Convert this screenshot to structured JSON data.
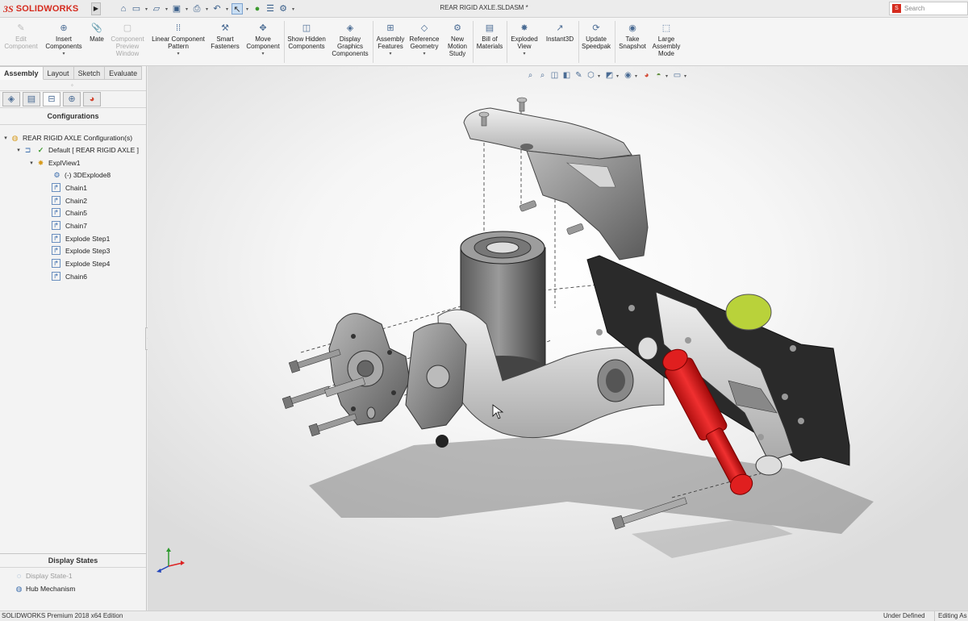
{
  "app": {
    "logo_mark": "3S",
    "logo_text": "SOLIDWORKS",
    "document_title": "REAR RIGID AXLE.SLDASM *",
    "search_placeholder": "Search MySolidWorks"
  },
  "quick_access": {
    "icons": [
      "home-icon",
      "new-document-icon",
      "open-icon",
      "save-icon",
      "print-icon",
      "undo-icon",
      "select-icon",
      "traffic-light-icon",
      "file-properties-icon",
      "options-icon"
    ]
  },
  "ribbon": {
    "edit_component": "Edit Component",
    "insert_components": "Insert Components",
    "mate": "Mate",
    "component_preview": "Component Preview Window",
    "linear_pattern": "Linear Component Pattern",
    "smart_fasteners": "Smart Fasteners",
    "move_component": "Move Component",
    "show_hidden": "Show Hidden Components",
    "display_graphics": "Display Graphics Components",
    "assembly_features": "Assembly Features",
    "reference_geometry": "Reference Geometry",
    "new_motion_study": "New Motion Study",
    "bill_of_materials": "Bill of Materials",
    "exploded_view": "Exploded View",
    "instant3d": "Instant3D",
    "update_speedpak": "Update Speedpak",
    "take_snapshot": "Take Snapshot",
    "large_assembly_mode": "Large Assembly Mode"
  },
  "tabs": [
    "Assembly",
    "Layout",
    "Sketch",
    "Evaluate"
  ],
  "config_manager": {
    "title": "Configurations",
    "tree": [
      "REAR RIGID AXLE Configuration(s)",
      "Default [ REAR RIGID AXLE ]",
      "ExplView1",
      "(-) 3DExplode8",
      "Chain1",
      "Chain2",
      "Chain5",
      "Chain7",
      "Explode Step1",
      "Explode Step3",
      "Explode Step4",
      "Chain6"
    ]
  },
  "display_states": {
    "title": "Display States",
    "items": [
      "Display State-1",
      "Hub Mechanism"
    ]
  },
  "status": {
    "edition": "SOLIDWORKS Premium 2018 x64 Edition",
    "state": "Under Defined",
    "mode": "Editing As"
  },
  "colors": {
    "brand_red": "#d52b1e",
    "shock_red": "#e01f1f",
    "accent_green": "#b9d23a",
    "metal_gray": "#8a8a8a"
  }
}
